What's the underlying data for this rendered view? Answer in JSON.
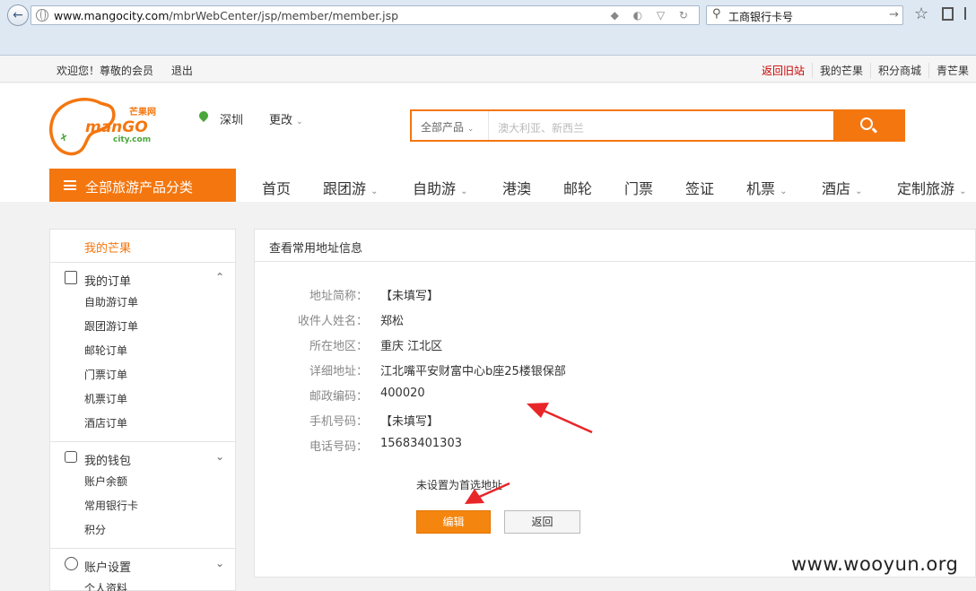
{
  "browser": {
    "url_host": "www.mangocity.com",
    "url_path": "/mbrWebCenter/jsp/member/member.jsp",
    "search_value": "工商银行卡号"
  },
  "topbar": {
    "welcome": "欢迎您！尊敬的会员",
    "logout": "退出",
    "links": [
      "返回旧站",
      "我的芒果",
      "积分商城",
      "青芒果"
    ]
  },
  "header": {
    "logo_brand": "芒果网",
    "logo_word": "manGO",
    "logo_sub": "city.com",
    "city": "深圳",
    "change": "更改",
    "search_category": "全部产品",
    "search_placeholder": "澳大利亚、新西兰"
  },
  "nav": {
    "all_label": "全部旅游产品分类",
    "items": [
      "首页",
      "跟团游",
      "自助游",
      "港澳",
      "邮轮",
      "门票",
      "签证",
      "机票",
      "酒店",
      "定制旅游"
    ]
  },
  "sidebar": {
    "my_mango": "我的芒果",
    "orders_title": "我的订单",
    "orders": [
      "自助游订单",
      "跟团游订单",
      "邮轮订单",
      "门票订单",
      "机票订单",
      "酒店订单"
    ],
    "wallet_title": "我的钱包",
    "wallet": [
      "账户余额",
      "常用银行卡",
      "积分"
    ],
    "settings_title": "账户设置",
    "settings": [
      "个人资料"
    ]
  },
  "panel": {
    "title": "查看常用地址信息",
    "fields": [
      {
        "label": "地址简称：",
        "value": "【未填写】"
      },
      {
        "label": "收件人姓名：",
        "value": "郑松"
      },
      {
        "label": "所在地区：",
        "value": "重庆 江北区"
      },
      {
        "label": "详细地址：",
        "value": "江北嘴平安财富中心b座25楼银保部"
      },
      {
        "label": "邮政编码：",
        "value": "400020"
      },
      {
        "label": "手机号码：",
        "value": "【未填写】"
      },
      {
        "label": "电话号码：",
        "value": "15683401303"
      }
    ],
    "pref_note": "未设置为首选地址",
    "edit_label": "编辑",
    "back_label": "返回"
  },
  "watermark": "www.wooyun.org",
  "colors": {
    "accent": "#f4760f",
    "annotation_arrow": "#e8262a"
  }
}
